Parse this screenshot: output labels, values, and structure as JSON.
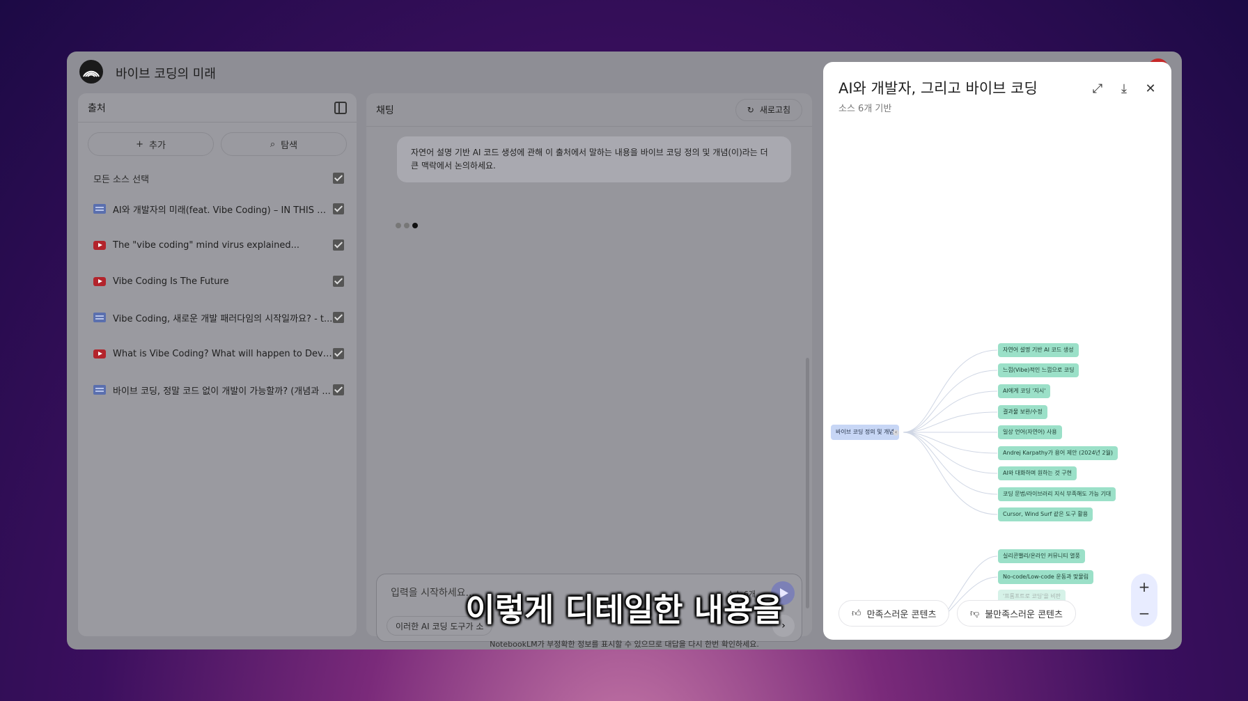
{
  "app": {
    "title": "바이브 코딩의 미래"
  },
  "sources": {
    "header": "출처",
    "add_label": "추가",
    "discover_label": "탐색",
    "select_all": "모든 소스 선택",
    "items": [
      {
        "type": "doc",
        "label": "AI와 개발자의 미래(feat. Vibe Coding) – IN THIS W..."
      },
      {
        "type": "youtube",
        "label": "The \"vibe coding\" mind virus explained..."
      },
      {
        "type": "youtube",
        "label": "Vibe Coding Is The Future"
      },
      {
        "type": "doc",
        "label": "Vibe Coding, 새로운 개발 패러다임의 시작일까요? - t..."
      },
      {
        "type": "youtube",
        "label": "What is Vibe Coding? What will happen to Devel..."
      },
      {
        "type": "doc",
        "label": "바이브 코딩, 정말 코드 없이 개발이 가능할까? (개념과 ..."
      }
    ]
  },
  "chat": {
    "header": "채팅",
    "refresh_label": "새로고침",
    "user_message": "자연어 설명 기반 AI 코드 생성에 관해 이 출처에서 말하는 내용을 바이브 코딩 정의 및 개념(이)라는 더 큰 맥락에서 논의하세요.",
    "input_placeholder": "입력을 시작하세요...",
    "source_count": "소스 6개",
    "suggestion": "이러한 AI 코딩 도구가 소"
  },
  "footer_note": "NotebookLM가 부정확한 정보를 표시할 수 있으므로 대답을 다시 한번 확인하세요.",
  "mindmap_panel": {
    "title": "AI와 개발자, 그리고 바이브 코딩",
    "subtitle": "소스 6개 기반",
    "root": "바이브 코딩 정의 및 개념",
    "children": [
      "자연어 설명 기반 AI 코드 생성",
      "느낌(Vibe)적인 느낌으로 코딩",
      "AI에게 코딩 '지시'",
      "결과물 보완/수정",
      "일상 언어(자연어) 사용",
      "Andrej Karpathy가 용어 제안 (2024년 2월)",
      "AI와 대화하며 원하는 것 구현",
      "코딩 문법/라이브러리 지식 부족해도 가능 기대",
      "Cursor, Wind Surf 같은 도구 활용"
    ],
    "lower_nodes": [
      "실리콘밸리/온라인 커뮤니티 열풍",
      "No-code/Low-code 운동과 맞물림",
      "'프롬프트로 코딩'을 비판"
    ],
    "like_label": "만족스러운 콘텐츠",
    "dislike_label": "불만족스러운 콘텐츠"
  },
  "caption": "이렇게 디테일한 내용을"
}
